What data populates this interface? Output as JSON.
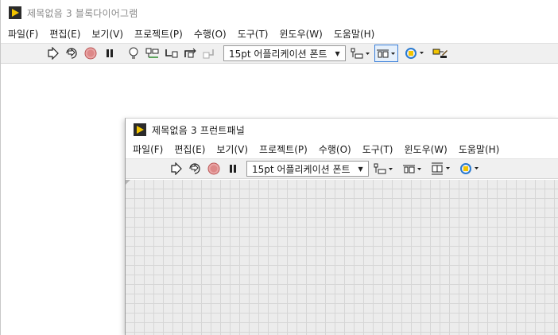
{
  "block_diagram": {
    "title": "제목없음 3 블록다이어그램",
    "menu": [
      "파일(F)",
      "편집(E)",
      "보기(V)",
      "프로젝트(P)",
      "수행(O)",
      "도구(T)",
      "윈도우(W)",
      "도움말(H)"
    ],
    "toolbar": {
      "font_select": "15pt 어플리케이션 폰트",
      "icons": [
        "run-arrow-icon",
        "run-continuously-icon",
        "abort-icon",
        "pause-icon",
        "highlight-execution-bulb-icon",
        "retain-wire-values-icon",
        "step-into-icon",
        "step-over-icon",
        "step-out-icon",
        "align-objects-icon",
        "distribute-objects-icon",
        "reorder-icon",
        "clean-up-diagram-icon"
      ]
    }
  },
  "front_panel": {
    "title": "제목없음 3 프런트패널",
    "menu": [
      "파일(F)",
      "편집(E)",
      "보기(V)",
      "프로젝트(P)",
      "수행(O)",
      "도구(T)",
      "윈도우(W)",
      "도움말(H)"
    ],
    "toolbar": {
      "font_select": "15pt 어플리케이션 폰트",
      "icons": [
        "run-arrow-icon",
        "run-continuously-icon",
        "abort-icon",
        "pause-icon",
        "align-objects-icon",
        "distribute-objects-icon",
        "resize-objects-icon",
        "reorder-icon"
      ]
    }
  },
  "colors": {
    "labview_icon_bg": "#2b2b2b",
    "labview_icon_arrow": "#f2c400",
    "toolbar_bg": "#f0f0f0",
    "panel_grid_bg": "#ececec",
    "grid_line": "#d6d6d6",
    "selected_tool_border": "#3b7fd9"
  }
}
